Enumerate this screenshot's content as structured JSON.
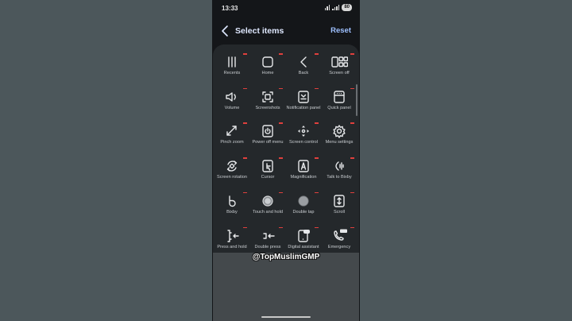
{
  "status_bar": {
    "time": "13:33",
    "battery": "80"
  },
  "header": {
    "title": "Select items",
    "reset_label": "Reset"
  },
  "items": [
    {
      "label": "Recents",
      "icon": "recents-icon"
    },
    {
      "label": "Home",
      "icon": "home-icon"
    },
    {
      "label": "Back",
      "icon": "back-icon"
    },
    {
      "label": "Screen off",
      "icon": "screen-off-icon"
    },
    {
      "label": "Volume",
      "icon": "volume-icon"
    },
    {
      "label": "Screenshots",
      "icon": "screenshot-icon"
    },
    {
      "label": "Notification panel",
      "icon": "notification-panel-icon"
    },
    {
      "label": "Quick panel",
      "icon": "quick-panel-icon"
    },
    {
      "label": "Pinch zoom",
      "icon": "pinch-zoom-icon"
    },
    {
      "label": "Power off menu",
      "icon": "power-icon"
    },
    {
      "label": "Screen control",
      "icon": "screen-control-icon"
    },
    {
      "label": "Menu settings",
      "icon": "settings-icon"
    },
    {
      "label": "Screen rotation",
      "icon": "rotation-icon"
    },
    {
      "label": "Cursor",
      "icon": "cursor-icon"
    },
    {
      "label": "Magnification",
      "icon": "magnification-icon"
    },
    {
      "label": "Talk to Bixby",
      "icon": "voice-icon"
    },
    {
      "label": "Bixby",
      "icon": "bixby-icon"
    },
    {
      "label": "Touch and hold",
      "icon": "touch-hold-icon"
    },
    {
      "label": "Double tap",
      "icon": "double-tap-icon"
    },
    {
      "label": "Scroll",
      "icon": "scroll-icon"
    },
    {
      "label": "Press and hold",
      "icon": "press-hold-icon"
    },
    {
      "label": "Double press",
      "icon": "double-press-icon"
    },
    {
      "label": "Digital assistant",
      "icon": "assistant-icon"
    },
    {
      "label": "Emergency",
      "icon": "emergency-icon"
    }
  ],
  "watermark": "@TopMuslimGMP",
  "colors": {
    "accent": "#9ec0ff",
    "remove": "#e0403d",
    "panel": "#24282b"
  }
}
